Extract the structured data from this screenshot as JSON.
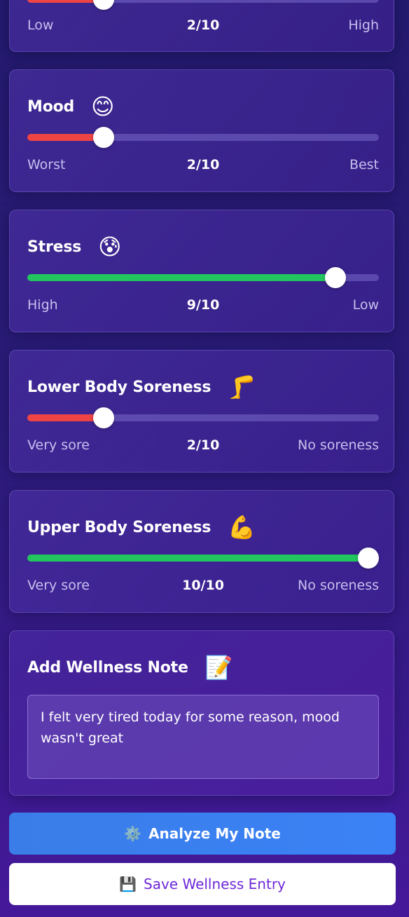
{
  "colors": {
    "low_fill": "#ef4444",
    "high_fill": "#22c55e",
    "analyze_button": "#3b82f6",
    "save_text": "#6d28d9"
  },
  "energy": {
    "value": 2,
    "max": 10,
    "min_label": "Low",
    "max_label": "High",
    "value_text": "2/10"
  },
  "mood": {
    "title": "Mood",
    "emoji": "😊",
    "icon": "smiling-face-icon",
    "value": 2,
    "max": 10,
    "min_label": "Worst",
    "max_label": "Best",
    "value_text": "2/10"
  },
  "stress": {
    "title": "Stress",
    "emoji": "😰",
    "icon": "anxious-face-icon",
    "value": 9,
    "max": 10,
    "min_label": "High",
    "max_label": "Low",
    "value_text": "9/10"
  },
  "lower_body": {
    "title": "Lower Body Soreness",
    "emoji": "🦵",
    "icon": "leg-icon",
    "value": 2,
    "max": 10,
    "min_label": "Very sore",
    "max_label": "No soreness",
    "value_text": "2/10"
  },
  "upper_body": {
    "title": "Upper Body Soreness",
    "emoji": "💪",
    "icon": "flexed-biceps-icon",
    "value": 10,
    "max": 10,
    "min_label": "Very sore",
    "max_label": "No soreness",
    "value_text": "10/10"
  },
  "note": {
    "title": "Add Wellness Note",
    "emoji": "📝",
    "icon": "memo-icon",
    "value": "I felt very tired today for some reason, mood wasn't great"
  },
  "buttons": {
    "analyze_label": "Analyze My Note",
    "analyze_icon": "⚙️",
    "save_label": "Save Wellness Entry",
    "save_icon": "💾"
  }
}
